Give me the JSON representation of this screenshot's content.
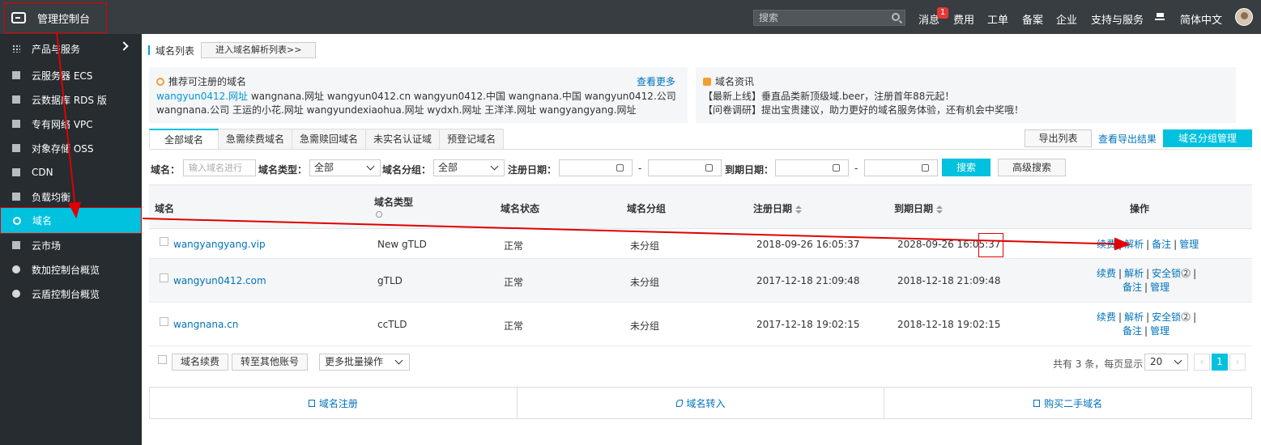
{
  "topbar": {
    "brand": "管理控制台",
    "search_placeholder": "搜索",
    "links": {
      "messages": "消息",
      "fees": "费用",
      "tickets": "工单",
      "filing": "备案",
      "enterprise": "企业",
      "support": "支持与服务",
      "language": "简体中文"
    },
    "message_badge": "1"
  },
  "sidebar": {
    "products": "产品与服务",
    "items": [
      {
        "label": "云服务器 ECS",
        "icon": "server-icon"
      },
      {
        "label": "云数据库 RDS 版",
        "icon": "database-icon"
      },
      {
        "label": "专有网络 VPC",
        "icon": "cloud-network-icon"
      },
      {
        "label": "对象存储 OSS",
        "icon": "storage-icon"
      },
      {
        "label": "CDN",
        "icon": "cdn-icon"
      },
      {
        "label": "负载均衡",
        "icon": "load-balancer-icon"
      },
      {
        "label": "域名",
        "icon": "globe-icon",
        "active": true
      },
      {
        "label": "云市场",
        "icon": "market-icon"
      },
      {
        "label": "数加控制台概览",
        "icon": "circle-icon"
      },
      {
        "label": "云盾控制台概览",
        "icon": "circle-icon"
      }
    ]
  },
  "header": {
    "title": "域名列表",
    "resolve_button": "进入域名解析列表>>"
  },
  "recommend": {
    "title": "推荐可注册的域名",
    "see_more": "查看更多",
    "line1_highlight": "wangyun0412.网址",
    "line1_rest": " wangnana.网址 wangyun0412.cn wangyun0412.中国 wangnana.中国 wangyun0412.公司",
    "line2": "wangnana.公司 王运的小花.网址 wangyundexiaohua.网址 wydxh.网址 王洋洋.网址 wangyangyang.网址"
  },
  "news": {
    "title": "域名资讯",
    "line1": "【最新上线】垂直品类新顶级域.beer，注册首年88元起！",
    "line2": "【问卷调研】提出宝贵建议，助力更好的域名服务体验，还有机会中奖哦！"
  },
  "tabs": [
    "全部域名",
    "急需续费域名",
    "急需赎回域名",
    "未实名认证域",
    "预登记域名"
  ],
  "toolbar": {
    "export": "导出列表",
    "export_results": "查看导出结果",
    "group_manage": "域名分组管理"
  },
  "filters": {
    "domain_label": "域名：",
    "domain_placeholder": "输入域名进行",
    "type_label": "域名类型：",
    "type_value": "全部",
    "group_label": "域名分组：",
    "group_value": "全部",
    "reg_label": "注册日期：",
    "exp_label": "到期日期：",
    "dash": "-",
    "search": "搜索",
    "advanced": "高级搜索"
  },
  "table": {
    "headers": {
      "domain": "域名",
      "type": "域名类型",
      "status": "域名状态",
      "group": "域名分组",
      "reg": "注册日期",
      "exp": "到期日期",
      "ops": "操作"
    },
    "rows": [
      {
        "domain": "wangyangyang.vip",
        "type": "New gTLD",
        "status": "正常",
        "group": "未分组",
        "reg": "2018-09-26 16:05:37",
        "exp": "2028-09-26 16:05:37"
      },
      {
        "domain": "wangyun0412.com",
        "type": "gTLD",
        "status": "正常",
        "group": "未分组",
        "reg": "2017-12-18 21:09:48",
        "exp": "2018-12-18 21:09:48"
      },
      {
        "domain": "wangnana.cn",
        "type": "ccTLD",
        "status": "正常",
        "group": "未分组",
        "reg": "2017-12-18 19:02:15",
        "exp": "2018-12-18 19:02:15"
      }
    ],
    "ops": {
      "renew": "续费",
      "resolve": "解析",
      "lock": "安全锁",
      "note": "备注",
      "manage": "管理"
    }
  },
  "batch": {
    "renew": "域名续费",
    "transfer": "转至其他账号",
    "more": "更多批量操作",
    "total": "共有 3 条，每页显示：",
    "page_size": "20",
    "current_page": "1"
  },
  "bottom_actions": [
    "域名注册",
    "域名转入",
    "购买二手域名"
  ],
  "colors": {
    "accent": "#00c1de",
    "topbar": "#373d41",
    "sidebar": "#262c30",
    "annotation": "#e00000"
  }
}
